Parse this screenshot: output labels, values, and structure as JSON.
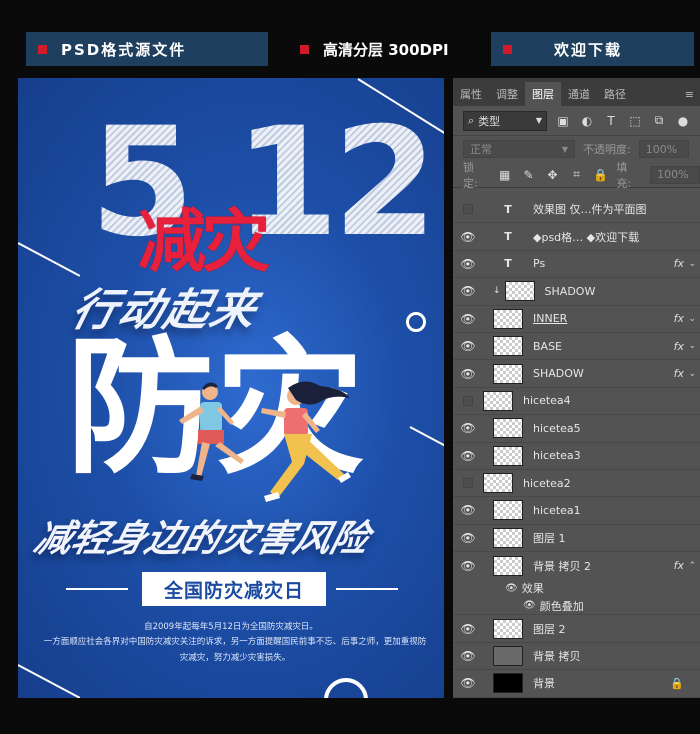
{
  "banners": {
    "left": "PSD格式源文件",
    "middle": "高清分层 300DPI",
    "right": "欢迎下载"
  },
  "poster": {
    "big_number": "5 12",
    "title_red": "减灾",
    "subtitle": "行动起来",
    "headline": "防灾",
    "slogan": "减轻身边的灾害风险",
    "day_label": "全国防灾减灾日",
    "note_line1": "自2009年起每年5月12日为全国防灾减灾日。",
    "note_line2": "一方面顺应社会各界对中国防灾减灾关注的诉求，另一方面提醒国民前事不忘、后事之师，更加重视防灾减灾，努力减少灾害损失。"
  },
  "panel": {
    "tabs": [
      "属性",
      "调整",
      "图层",
      "通道",
      "路径"
    ],
    "active_tab": "图层",
    "kind_label": "类型",
    "blend_mode": "正常",
    "opacity_label": "不透明度:",
    "opacity_value": "100%",
    "lock_label": "锁定:",
    "fill_label": "填充:",
    "fill_value": "100%",
    "layers": [
      {
        "name": "效果图 仅…件为平面图",
        "type": "text",
        "visible": false,
        "fx": false
      },
      {
        "name": "◆psd格… ◆欢迎下载",
        "type": "text",
        "visible": true,
        "fx": false
      },
      {
        "name": "Ps",
        "type": "text",
        "visible": true,
        "fx": true
      },
      {
        "name": "SHADOW",
        "type": "image",
        "visible": true,
        "fx": false,
        "clipped": true
      },
      {
        "name": "INNER",
        "type": "image",
        "visible": true,
        "fx": true
      },
      {
        "name": "BASE",
        "type": "image",
        "visible": true,
        "fx": true
      },
      {
        "name": "SHADOW",
        "type": "image",
        "visible": true,
        "fx": true
      },
      {
        "name": "hicetea4",
        "type": "image",
        "visible": false,
        "fx": false
      },
      {
        "name": "hicetea5",
        "type": "image",
        "visible": true,
        "fx": false
      },
      {
        "name": "hicetea3",
        "type": "image",
        "visible": true,
        "fx": false
      },
      {
        "name": "hicetea2",
        "type": "image",
        "visible": false,
        "fx": false
      },
      {
        "name": "hicetea1",
        "type": "image",
        "visible": true,
        "fx": false
      },
      {
        "name": "图层 1",
        "type": "image",
        "visible": true,
        "fx": false
      },
      {
        "name": "背景 拷贝 2",
        "type": "image",
        "visible": true,
        "fx": true,
        "expanded": true
      }
    ],
    "effects_label": "效果",
    "effect_item": "颜色叠加",
    "layers_after": [
      {
        "name": "图层 2",
        "type": "image",
        "visible": true
      },
      {
        "name": "背景 拷贝",
        "type": "gray",
        "visible": true
      },
      {
        "name": "背景",
        "type": "black",
        "visible": true,
        "locked": true
      }
    ]
  }
}
